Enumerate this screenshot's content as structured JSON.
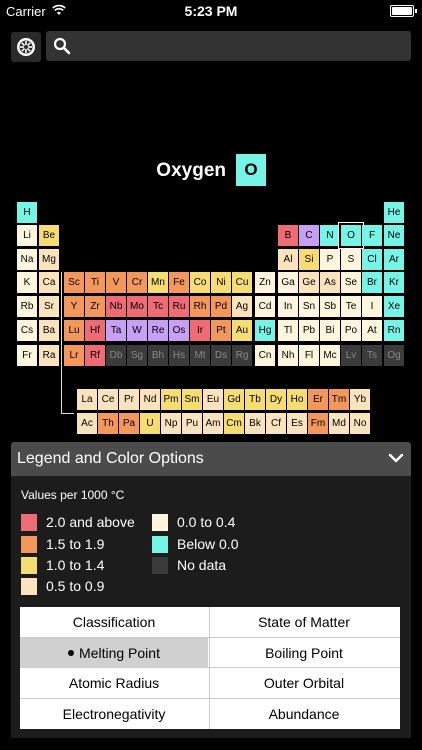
{
  "status": {
    "carrier": "Carrier",
    "time": "5:23 PM"
  },
  "search": {
    "placeholder": ""
  },
  "selected": {
    "name": "Oxygen",
    "symbol": "O"
  },
  "colors": {
    "high": "#ef6b76",
    "mid_high": "#f4975b",
    "mid": "#f6dd72",
    "low_mid": "#fbe3bd",
    "low": "#fef5dc",
    "below_zero": "#76f4e6",
    "no_data": "#3b3b3b",
    "purple": "#c79ff5",
    "blue": "#a9d4f5",
    "sage": "#c4d8b5"
  },
  "elements": [
    {
      "s": "H",
      "c": "below_zero"
    },
    {
      "s": "He",
      "c": "below_zero"
    },
    {
      "s": "Li",
      "c": "low"
    },
    {
      "s": "Be",
      "c": "mid"
    },
    {
      "s": "B",
      "c": "high"
    },
    {
      "s": "C",
      "c": "purple"
    },
    {
      "s": "N",
      "c": "below_zero"
    },
    {
      "s": "O",
      "c": "below_zero"
    },
    {
      "s": "F",
      "c": "below_zero"
    },
    {
      "s": "Ne",
      "c": "below_zero"
    },
    {
      "s": "Na",
      "c": "low"
    },
    {
      "s": "Mg",
      "c": "low_mid"
    },
    {
      "s": "Al",
      "c": "low_mid"
    },
    {
      "s": "Si",
      "c": "mid"
    },
    {
      "s": "P",
      "c": "low"
    },
    {
      "s": "S",
      "c": "low"
    },
    {
      "s": "Cl",
      "c": "below_zero"
    },
    {
      "s": "Ar",
      "c": "below_zero"
    },
    {
      "s": "K",
      "c": "low"
    },
    {
      "s": "Ca",
      "c": "low_mid"
    },
    {
      "s": "Sc",
      "c": "mid_high"
    },
    {
      "s": "Ti",
      "c": "mid_high"
    },
    {
      "s": "V",
      "c": "mid_high"
    },
    {
      "s": "Cr",
      "c": "mid_high"
    },
    {
      "s": "Mn",
      "c": "mid"
    },
    {
      "s": "Fe",
      "c": "mid_high"
    },
    {
      "s": "Co",
      "c": "mid"
    },
    {
      "s": "Ni",
      "c": "mid"
    },
    {
      "s": "Cu",
      "c": "mid"
    },
    {
      "s": "Zn",
      "c": "low"
    },
    {
      "s": "Ga",
      "c": "low"
    },
    {
      "s": "Ge",
      "c": "low_mid"
    },
    {
      "s": "As",
      "c": "low_mid"
    },
    {
      "s": "Se",
      "c": "low"
    },
    {
      "s": "Br",
      "c": "below_zero"
    },
    {
      "s": "Kr",
      "c": "below_zero"
    },
    {
      "s": "Rb",
      "c": "low"
    },
    {
      "s": "Sr",
      "c": "low_mid"
    },
    {
      "s": "Y",
      "c": "mid_high"
    },
    {
      "s": "Zr",
      "c": "mid_high"
    },
    {
      "s": "Nb",
      "c": "high"
    },
    {
      "s": "Mo",
      "c": "high"
    },
    {
      "s": "Tc",
      "c": "high"
    },
    {
      "s": "Ru",
      "c": "high"
    },
    {
      "s": "Rh",
      "c": "mid_high"
    },
    {
      "s": "Pd",
      "c": "mid_high"
    },
    {
      "s": "Ag",
      "c": "low_mid"
    },
    {
      "s": "Cd",
      "c": "low"
    },
    {
      "s": "In",
      "c": "low"
    },
    {
      "s": "Sn",
      "c": "low"
    },
    {
      "s": "Sb",
      "c": "low"
    },
    {
      "s": "Te",
      "c": "low"
    },
    {
      "s": "I",
      "c": "low"
    },
    {
      "s": "Xe",
      "c": "below_zero"
    },
    {
      "s": "Cs",
      "c": "low"
    },
    {
      "s": "Ba",
      "c": "low_mid"
    },
    {
      "s": "Lu",
      "c": "mid_high"
    },
    {
      "s": "Hf",
      "c": "high"
    },
    {
      "s": "Ta",
      "c": "purple"
    },
    {
      "s": "W",
      "c": "purple"
    },
    {
      "s": "Re",
      "c": "purple"
    },
    {
      "s": "Os",
      "c": "purple"
    },
    {
      "s": "Ir",
      "c": "high"
    },
    {
      "s": "Pt",
      "c": "mid_high"
    },
    {
      "s": "Au",
      "c": "mid"
    },
    {
      "s": "Hg",
      "c": "below_zero"
    },
    {
      "s": "Tl",
      "c": "low"
    },
    {
      "s": "Pb",
      "c": "low"
    },
    {
      "s": "Bi",
      "c": "low"
    },
    {
      "s": "Po",
      "c": "low"
    },
    {
      "s": "At",
      "c": "low"
    },
    {
      "s": "Rn",
      "c": "below_zero"
    },
    {
      "s": "Fr",
      "c": "low"
    },
    {
      "s": "Ra",
      "c": "low_mid"
    },
    {
      "s": "Lr",
      "c": "mid_high"
    },
    {
      "s": "Rf",
      "c": "high"
    },
    {
      "s": "Db",
      "c": "no_data"
    },
    {
      "s": "Sg",
      "c": "no_data"
    },
    {
      "s": "Bh",
      "c": "no_data"
    },
    {
      "s": "Hs",
      "c": "no_data"
    },
    {
      "s": "Mt",
      "c": "no_data"
    },
    {
      "s": "Ds",
      "c": "no_data"
    },
    {
      "s": "Rg",
      "c": "no_data"
    },
    {
      "s": "Cn",
      "c": "low"
    },
    {
      "s": "Nh",
      "c": "low"
    },
    {
      "s": "Fl",
      "c": "low"
    },
    {
      "s": "Mc",
      "c": "low"
    },
    {
      "s": "Lv",
      "c": "no_data"
    },
    {
      "s": "Ts",
      "c": "no_data"
    },
    {
      "s": "Og",
      "c": "no_data"
    },
    {
      "s": "La",
      "c": "low_mid"
    },
    {
      "s": "Ce",
      "c": "low_mid"
    },
    {
      "s": "Pr",
      "c": "low_mid"
    },
    {
      "s": "Nd",
      "c": "low_mid"
    },
    {
      "s": "Pm",
      "c": "mid"
    },
    {
      "s": "Sm",
      "c": "mid"
    },
    {
      "s": "Eu",
      "c": "low_mid"
    },
    {
      "s": "Gd",
      "c": "mid"
    },
    {
      "s": "Tb",
      "c": "mid"
    },
    {
      "s": "Dy",
      "c": "mid"
    },
    {
      "s": "Ho",
      "c": "mid"
    },
    {
      "s": "Er",
      "c": "mid_high"
    },
    {
      "s": "Tm",
      "c": "mid_high"
    },
    {
      "s": "Yb",
      "c": "low_mid"
    },
    {
      "s": "Ac",
      "c": "low_mid"
    },
    {
      "s": "Th",
      "c": "mid_high"
    },
    {
      "s": "Pa",
      "c": "mid_high"
    },
    {
      "s": "U",
      "c": "mid"
    },
    {
      "s": "Np",
      "c": "low_mid"
    },
    {
      "s": "Pu",
      "c": "low_mid"
    },
    {
      "s": "Am",
      "c": "low_mid"
    },
    {
      "s": "Cm",
      "c": "mid"
    },
    {
      "s": "Bk",
      "c": "low_mid"
    },
    {
      "s": "Cf",
      "c": "low_mid"
    },
    {
      "s": "Es",
      "c": "low_mid"
    },
    {
      "s": "Fm",
      "c": "mid_high"
    },
    {
      "s": "Md",
      "c": "low_mid"
    },
    {
      "s": "No",
      "c": "low_mid"
    }
  ],
  "legend": {
    "title": "Legend and Color Options",
    "caption": "Values per 1000 °C",
    "items": [
      {
        "label": "2.0 and above",
        "color": "#ef6b76"
      },
      {
        "label": "1.5 to 1.9",
        "color": "#f4975b"
      },
      {
        "label": "1.0 to 1.4",
        "color": "#f6dd72"
      },
      {
        "label": "0.5 to 0.9",
        "color": "#fbe3bd"
      },
      {
        "label": "0.0 to 0.4",
        "color": "#fef5dc"
      },
      {
        "label": "Below 0.0",
        "color": "#76f4e6"
      },
      {
        "label": "No data",
        "color": "#3b3b3b"
      }
    ]
  },
  "options": {
    "classification": "Classification",
    "state_of_matter": "State of Matter",
    "melting_point": "Melting Point",
    "boiling_point": "Boiling Point",
    "atomic_radius": "Atomic Radius",
    "outer_orbital": "Outer Orbital",
    "electronegativity": "Electronegativity",
    "abundance": "Abundance"
  }
}
